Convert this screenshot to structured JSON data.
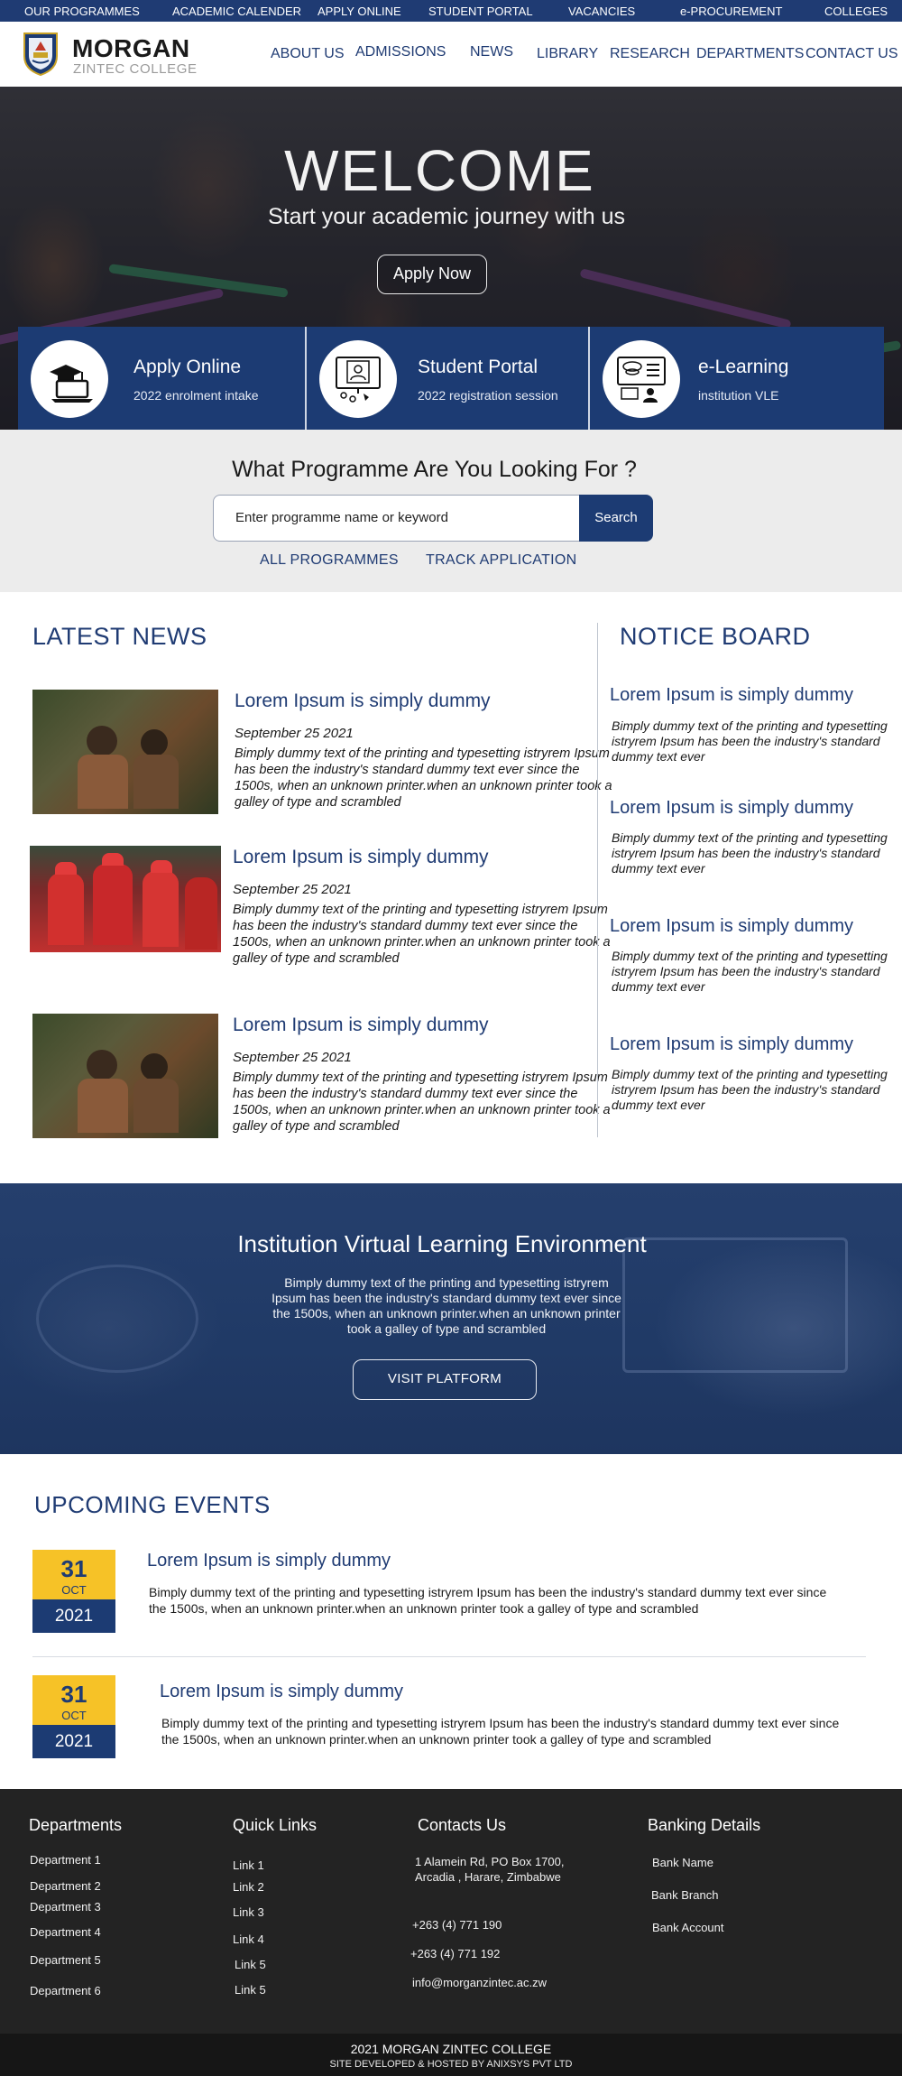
{
  "topbar": {
    "items": [
      "OUR  PROGRAMMES",
      "ACADEMIC CALENDER",
      "APPLY ONLINE",
      "STUDENT PORTAL",
      "VACANCIES",
      "e-PROCUREMENT",
      "COLLEGES"
    ]
  },
  "brand": {
    "name": "MORGAN",
    "sub": "ZINTEC COLLEGE"
  },
  "nav": {
    "items": [
      "ABOUT US",
      "ADMISSIONS",
      "NEWS",
      "LIBRARY",
      "RESEARCH",
      "DEPARTMENTS",
      "CONTACT US"
    ]
  },
  "hero": {
    "title": "WELCOME",
    "subtitle": "Start your academic journey with us",
    "button": "Apply Now"
  },
  "tiles": [
    {
      "title": "Apply Online",
      "sub": "2022 enrolment intake",
      "icon": "laptop-graduation-icon"
    },
    {
      "title": "Student Portal",
      "sub": "2022 registration session",
      "icon": "user-profile-screen-icon"
    },
    {
      "title": "e-Learning",
      "sub": "institution VLE",
      "icon": "webcam-monitor-icon"
    }
  ],
  "programme_search": {
    "title": "What Programme Are You Looking For ?",
    "placeholder": "Enter programme name or keyword",
    "button": "Search",
    "links": [
      "ALL PROGRAMMES",
      "TRACK APPLICATION"
    ]
  },
  "news": {
    "heading": "LATEST NEWS",
    "items": [
      {
        "title": "Lorem Ipsum is simply dummy",
        "date": "September 25 2021",
        "body": "Bimply dummy text of the printing and typesetting istryrem  Ipsum has been the industry's standard dummy text ever since the 1500s, when an unknown printer.when an unknown printer took a galley of type and scrambled"
      },
      {
        "title": "Lorem Ipsum is simply dummy",
        "date": "September 25 2021",
        "body": "Bimply dummy text of the printing and typesetting istryrem  Ipsum has been the industry's standard dummy text ever since the 1500s, when an unknown printer.when an unknown printer took a galley of type and scrambled"
      },
      {
        "title": "Lorem Ipsum is simply dummy",
        "date": "September 25 2021",
        "body": "Bimply dummy text of the printing and typesetting istryrem  Ipsum has been the industry's standard dummy text ever since the 1500s, when an unknown printer.when an unknown printer took a galley of type and scrambled"
      }
    ]
  },
  "notice": {
    "heading": "NOTICE BOARD",
    "items": [
      {
        "title": "Lorem Ipsum is simply dummy",
        "body": "Bimply dummy text of the printing and typesetting  istryrem Ipsum has been the industry's standard dummy text ever"
      },
      {
        "title": "Lorem Ipsum is simply dummy",
        "body": "Bimply dummy text of the printing and typesetting  istryrem Ipsum has been the industry's standard dummy text ever"
      },
      {
        "title": "Lorem Ipsum is simply dummy",
        "body": "Bimply dummy text of the printing and typesetting  istryrem Ipsum has been the industry's standard dummy text ever"
      },
      {
        "title": "Lorem Ipsum is simply dummy",
        "body": "Bimply dummy text of the printing and typesetting  istryrem Ipsum has been the industry's standard dummy text ever"
      }
    ]
  },
  "vle": {
    "title": "Institution Virtual Learning Environment",
    "body": "Bimply dummy text of the printing and typesetting istryrem Ipsum has been the industry's standard dummy text ever since the 1500s, when an unknown printer.when an unknown printer took a galley of type and scrambled",
    "button": "VISIT PLATFORM"
  },
  "events": {
    "heading": "UPCOMING EVENTS",
    "items": [
      {
        "day": "31",
        "month": "OCT",
        "year": "2021",
        "title": "Lorem Ipsum is simply dummy",
        "body": "Bimply dummy text of the printing and typesetting istryrem Ipsum has been the industry's standard dummy text ever  since the 1500s, when an unknown printer.when an unknown printer took a galley of type and scrambled"
      },
      {
        "day": "31",
        "month": "OCT",
        "year": "2021",
        "title": "Lorem Ipsum is simply dummy",
        "body": "Bimply dummy text of the printing and typesetting istryrem Ipsum has been the industry's standard dummy text ever  since the 1500s, when an unknown printer.when an unknown printer took a galley of type and scrambled"
      }
    ]
  },
  "footer": {
    "departments": {
      "heading": "Departments",
      "items": [
        "Department 1",
        "Department 2",
        "Department 3",
        "Department 4",
        "Department 5",
        "Department 6"
      ]
    },
    "quick_links": {
      "heading": "Quick Links",
      "items": [
        "Link 1",
        "Link 2",
        "Link 3",
        "Link 4",
        "Link 5",
        "Link 5"
      ]
    },
    "contacts": {
      "heading": "Contacts Us",
      "address": "1 Alamein Rd, PO Box 1700, Arcadia , Harare, Zimbabwe",
      "phone1": "+263 (4) 771 190",
      "phone2": "+263 (4) 771 192",
      "email": "info@morganzintec.ac.zw"
    },
    "banking": {
      "heading": "Banking Details",
      "items": [
        "Bank Name",
        "Bank Branch",
        "Bank Account"
      ]
    },
    "copyright": "2021 MORGAN ZINTEC COLLEGE",
    "developer": "SITE DEVELOPED & HOSTED BY ANIXSYS PVT LTD"
  },
  "colors": {
    "primary": "#1c3b73",
    "accent": "#f6c227",
    "footer": "#232323"
  }
}
